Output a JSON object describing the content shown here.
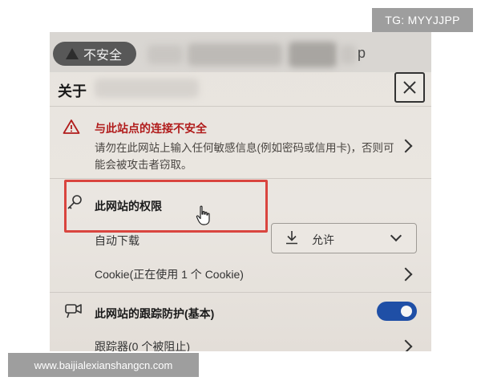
{
  "watermarks": {
    "top_right": "TG: MYYJJPP",
    "bottom_left": "www.baijialexianshangcn.com"
  },
  "address_bar": {
    "security_label": "不安全",
    "url_fragment": "p"
  },
  "panel": {
    "title": "关于",
    "close_symbol": "✕",
    "connection": {
      "title": "与此站点的连接不安全",
      "description": "请勿在此网站上输入任何敏感信息(例如密码或信用卡)，否则可能会被攻击者窃取。"
    },
    "permissions": {
      "title": "此网站的权限",
      "auto_download": {
        "label": "自动下载",
        "value": "允许"
      },
      "cookie": {
        "label": "Cookie(正在使用 1 个 Cookie)"
      }
    },
    "tracking": {
      "title": "此网站的跟踪防护(基本)",
      "enabled": true,
      "trackers_label": "跟踪器(0 个被阻止)"
    }
  },
  "colors": {
    "warning_red": "#b11c1c",
    "highlight_red": "#d9453f",
    "toggle_blue": "#1f4fa6"
  }
}
